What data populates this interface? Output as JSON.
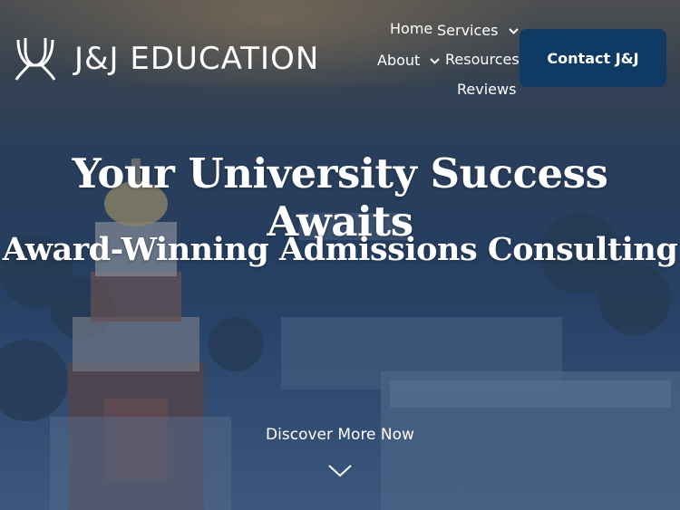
{
  "brand": {
    "name": "J&J EDUCATION",
    "logo_icon": "jj-monogram-icon"
  },
  "nav": {
    "home": "Home",
    "services": "Services",
    "about": "About",
    "resources": "Resources",
    "reviews": "Reviews",
    "dropdown_icon": "chevron-down-icon"
  },
  "cta": {
    "contact_label": "Contact J&J"
  },
  "hero": {
    "headline": "Your University Success Awaits",
    "subheadline": "Award-Winning Admissions Consulting",
    "discover_label": "Discover More Now",
    "scroll_icon": "chevron-down-icon"
  },
  "colors": {
    "button_bg": "#0f3a64",
    "text": "#ffffff",
    "overlay": "#2a4467"
  }
}
